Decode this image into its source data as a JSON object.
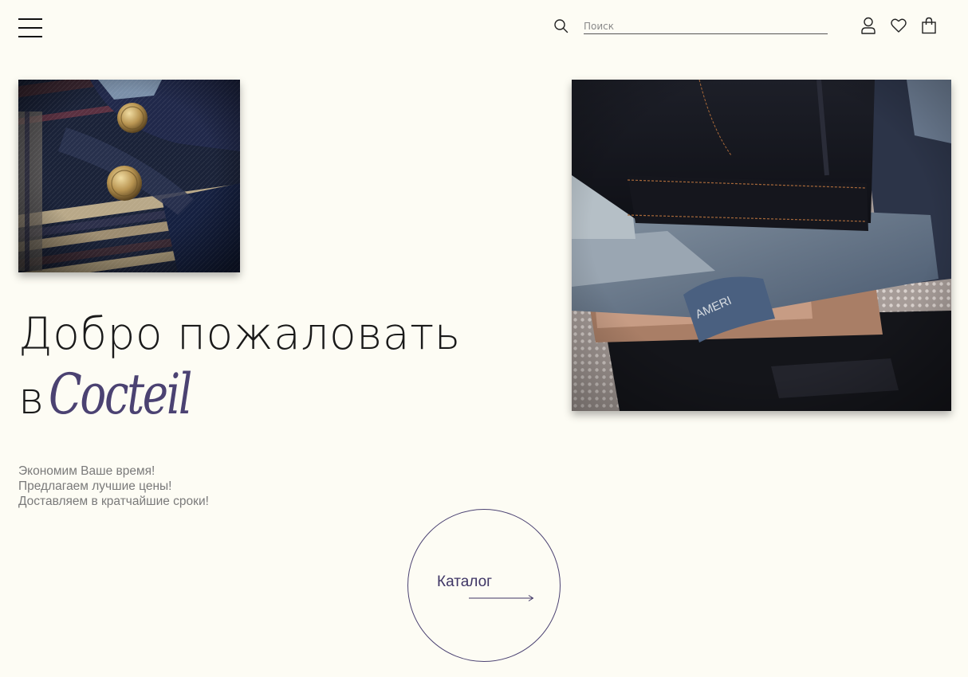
{
  "header": {
    "menu_icon": "hamburger-menu-icon",
    "search": {
      "placeholder": "Поиск",
      "value": "",
      "icon": "search-icon"
    },
    "icons": [
      "user-icon",
      "heart-icon",
      "shopping-bag-icon"
    ]
  },
  "hero": {
    "title_line1": "Добро пожаловать",
    "title_line2_prefix": "в",
    "brand": "Cocteil",
    "benefits": [
      "Экономим Ваше время!",
      "Предлагаем лучшие цены!",
      "Доставляем в кратчайшие сроки!"
    ]
  },
  "images": {
    "small": "plaid-shirt-photo",
    "large": "folded-jeans-photo"
  },
  "catalog_button": {
    "label": "Каталог",
    "icon": "arrow-right-icon"
  },
  "colors": {
    "background": "#fdfcf4",
    "accent": "#4b4272",
    "text": "#1a1a1a",
    "muted": "#7a7a7a"
  }
}
